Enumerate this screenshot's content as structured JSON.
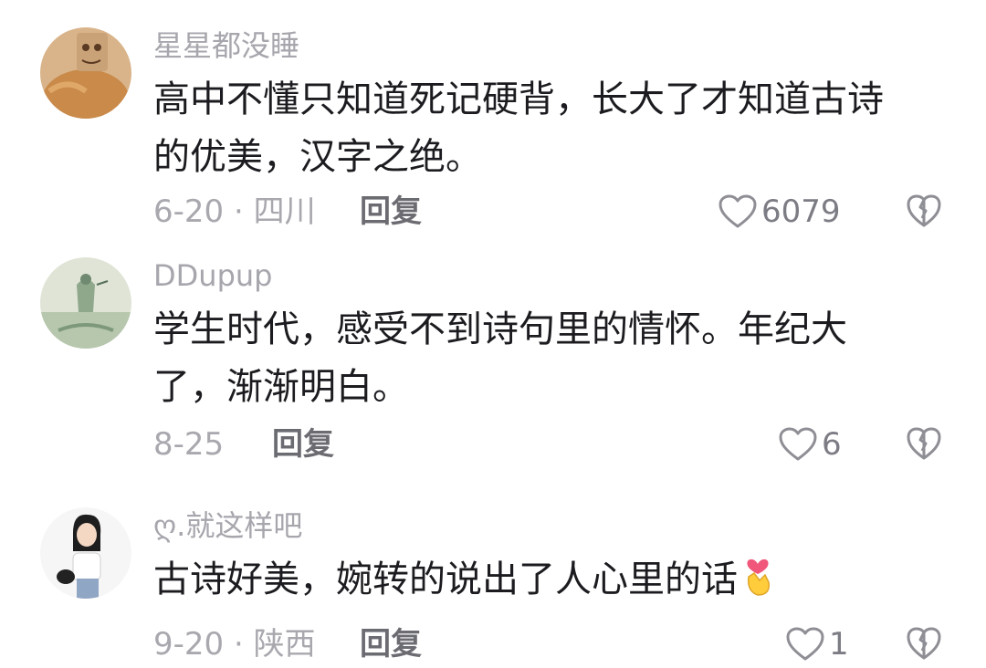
{
  "comments": [
    {
      "username": "星星都没睡",
      "text_lines": [
        "高中不懂只知道死记硬背，长大了才知道古诗",
        "的优美，汉字之绝。"
      ],
      "meta": "6-20 · 四川",
      "reply_label": "回复",
      "like_count": "6079",
      "avatar_icon": "cat-avatar-icon"
    },
    {
      "username": "DDupup",
      "text_lines": [
        "学生时代，感受不到诗句里的情怀。年纪大",
        "了，渐渐明白。"
      ],
      "meta": "8-25",
      "reply_label": "回复",
      "like_count": "6",
      "avatar_icon": "painting-avatar-icon"
    },
    {
      "username": "ღ.就这样吧",
      "text_lines": [
        "古诗好美，婉转的说出了人心里的话"
      ],
      "meta": "9-20 · 陕西",
      "reply_label": "回复",
      "like_count": "1",
      "emoji": "finger-heart-emoji",
      "avatar_icon": "girl-avatar-icon"
    }
  ],
  "icons": {
    "like": "heart-outline-icon",
    "dislike": "broken-heart-icon"
  },
  "colors": {
    "username": "#a6a6ad",
    "text": "#1c1c20",
    "meta": "#a8a8ae",
    "reply": "#6b6b72",
    "icon": "#8e8e95"
  }
}
